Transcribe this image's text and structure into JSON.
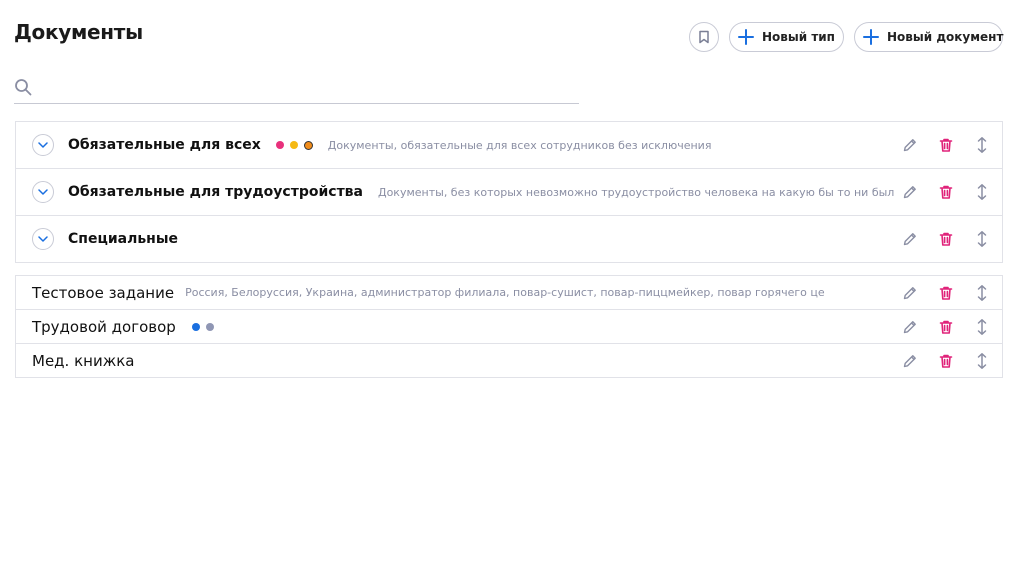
{
  "page": {
    "title": "Документы"
  },
  "toolbar": {
    "new_type_label": "Новый тип",
    "new_document_label": "Новый документ",
    "bookmark_icon": "bookmark-icon",
    "plus_icon": "plus-icon"
  },
  "search": {
    "placeholder": "",
    "value": "",
    "icon": "search-icon"
  },
  "colors": {
    "accent": "#1a6fe0",
    "delete": "#e0237a",
    "muted": "#8a8ea3",
    "dot_pink": "#e8317c",
    "dot_yellow": "#f5b914",
    "dot_orange": "#f08c1a",
    "dot_blue": "#1a6fe0",
    "dot_gray": "#8f96b4"
  },
  "groups": [
    {
      "name": "Обязательные для всех",
      "description": "Документы, обязательные для всех сотрудников без исключения",
      "dots": [
        "#e8317c",
        "#f5b914",
        "#f08c1a"
      ]
    },
    {
      "name": "Обязательные для трудоустройства",
      "description": "Документы, без которых невозможно трудоустройство человека на какую бы то ни было должность в компании",
      "dots": []
    },
    {
      "name": "Специальные",
      "description": "",
      "dots": []
    }
  ],
  "documents": [
    {
      "name": "Тестовое задание",
      "description": "Россия, Белоруссия, Украина, администратор филиала, повар-сушист, повар-пиццмейкер, повар горячего цеха",
      "dots": []
    },
    {
      "name": "Трудовой договор",
      "description": "",
      "dots": [
        "#1a6fe0",
        "#8f96b4"
      ]
    },
    {
      "name": "Мед. книжка",
      "description": "",
      "dots": []
    }
  ],
  "row_icons": [
    "pencil-icon",
    "trash-icon",
    "drag-handle-icon"
  ]
}
